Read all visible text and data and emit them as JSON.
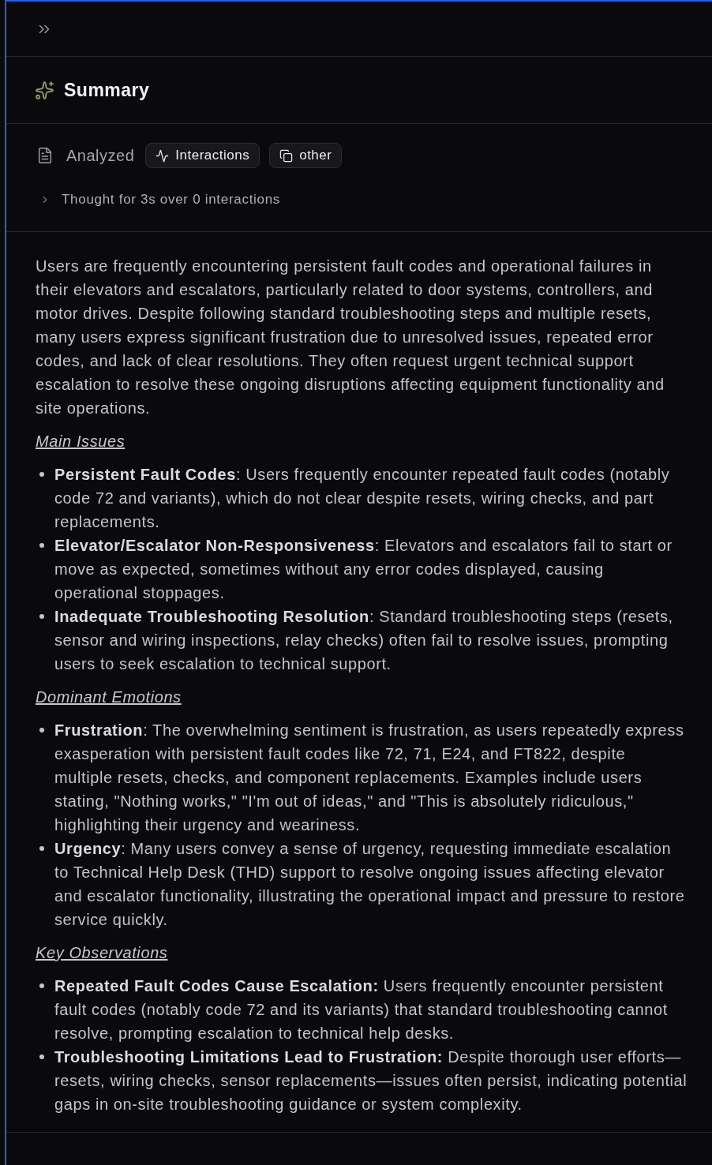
{
  "header": {
    "title": "Summary"
  },
  "analysis": {
    "label": "Analyzed",
    "chips": [
      {
        "label": "Interactions",
        "kind": "activity"
      },
      {
        "label": "other",
        "kind": "copy"
      }
    ],
    "thought": {
      "text": "Thought for 3s over 0 interactions",
      "expanded": false
    }
  },
  "summary": {
    "intro": "Users are frequently encountering persistent fault codes and operational failures in their elevators and escalators, particularly related to door systems, controllers, and motor drives. Despite following standard troubleshooting steps and multiple resets, many users express significant frustration due to unresolved issues, repeated error codes, and lack of clear resolutions. They often request urgent technical support escalation to resolve these ongoing disruptions affecting equipment functionality and site operations.",
    "sections": [
      {
        "heading": "Main Issues",
        "items": [
          "**Persistent Fault Codes**: Users frequently encounter repeated fault codes (notably code 72 and variants), which do not clear despite resets, wiring checks, and part replacements.",
          "**Elevator/Escalator Non-Responsiveness**: Elevators and escalators fail to start or move as expected, sometimes without any error codes displayed, causing operational stoppages.",
          "**Inadequate Troubleshooting Resolution**: Standard troubleshooting steps (resets, sensor and wiring inspections, relay checks) often fail to resolve issues, prompting users to seek escalation to technical support."
        ]
      },
      {
        "heading": "Dominant Emotions",
        "items": [
          "**Frustration**: The overwhelming sentiment is frustration, as users repeatedly express exasperation with persistent fault codes like 72, 71, E24, and FT822, despite multiple resets, checks, and component replacements. Examples include users stating, \"Nothing works,\" \"I'm out of ideas,\" and \"This is absolutely ridiculous,\" highlighting their urgency and weariness.",
          "**Urgency**: Many users convey a sense of urgency, requesting immediate escalation to Technical Help Desk (THD) support to resolve ongoing issues affecting elevator and escalator functionality, illustrating the operational impact and pressure to restore service quickly."
        ]
      },
      {
        "heading": "Key Observations",
        "items": [
          "**Repeated Fault Codes Cause Escalation:** Users frequently encounter persistent fault codes (notably code 72 and its variants) that standard troubleshooting cannot resolve, prompting escalation to technical help desks.",
          "**Troubleshooting Limitations Lead to Frustration:** Despite thorough user efforts—resets, wiring checks, sensor replacements—issues often persist, indicating potential gaps in on-site troubleshooting guidance or system complexity."
        ]
      }
    ]
  }
}
